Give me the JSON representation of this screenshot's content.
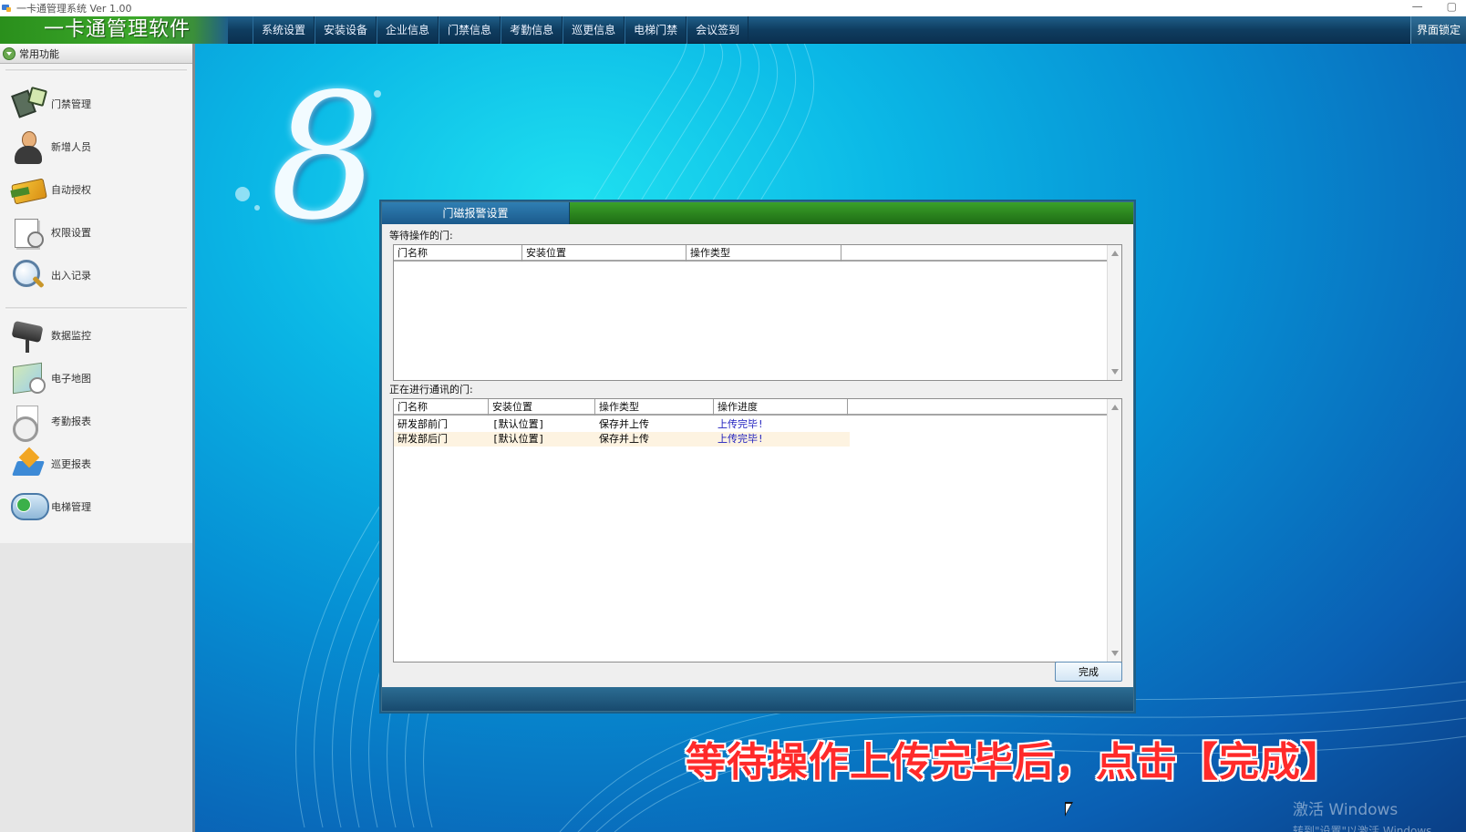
{
  "window": {
    "title": "一卡通管理系统  Ver 1.00",
    "controls": [
      "—",
      "▢"
    ]
  },
  "app": {
    "brand": "一卡通管理软件"
  },
  "menu": {
    "items": [
      "系统设置",
      "安装设备",
      "企业信息",
      "门禁信息",
      "考勤信息",
      "巡更信息",
      "电梯门禁",
      "会议签到"
    ],
    "lock_label": "界面锁定"
  },
  "sidebar": {
    "header": "常用功能",
    "group1": [
      {
        "label": "门禁管理",
        "icon": "door-controller-icon"
      },
      {
        "label": "新增人员",
        "icon": "person-icon"
      },
      {
        "label": "自动授权",
        "icon": "card-icon"
      },
      {
        "label": "权限设置",
        "icon": "permission-icon"
      },
      {
        "label": "出入记录",
        "icon": "magnifier-icon"
      }
    ],
    "group2": [
      {
        "label": "数据监控",
        "icon": "camera-icon"
      },
      {
        "label": "电子地图",
        "icon": "map-icon"
      },
      {
        "label": "考勤报表",
        "icon": "clock-icon"
      },
      {
        "label": "巡更报表",
        "icon": "patrol-icon"
      },
      {
        "label": "电梯管理",
        "icon": "elevator-icon"
      }
    ]
  },
  "background": {
    "logo_digit": "8"
  },
  "dialog": {
    "title": "门磁报警设置",
    "pending_label": "等待操作的门:",
    "pending_columns": [
      "门名称",
      "安装位置",
      "操作类型"
    ],
    "active_label": "正在进行通讯的门:",
    "active_columns": [
      "门名称",
      "安装位置",
      "操作类型",
      "操作进度"
    ],
    "active_rows": [
      {
        "name": "研发部前门",
        "location": "[默认位置]",
        "op": "保存并上传",
        "progress": "上传完毕!"
      },
      {
        "name": "研发部后门",
        "location": "[默认位置]",
        "op": "保存并上传",
        "progress": "上传完毕!"
      }
    ],
    "done_label": "完成"
  },
  "caption": "等待操作上传完毕后，点击【完成】",
  "watermark": {
    "line1": "激活 Windows",
    "line2": "转到\"设置\"以激活 Windows。"
  },
  "colors": {
    "caption": "#ff2a2a",
    "progress": "#1b1bbd",
    "brand_green": "#3ca82a",
    "menu_blue": "#0f3d60"
  }
}
